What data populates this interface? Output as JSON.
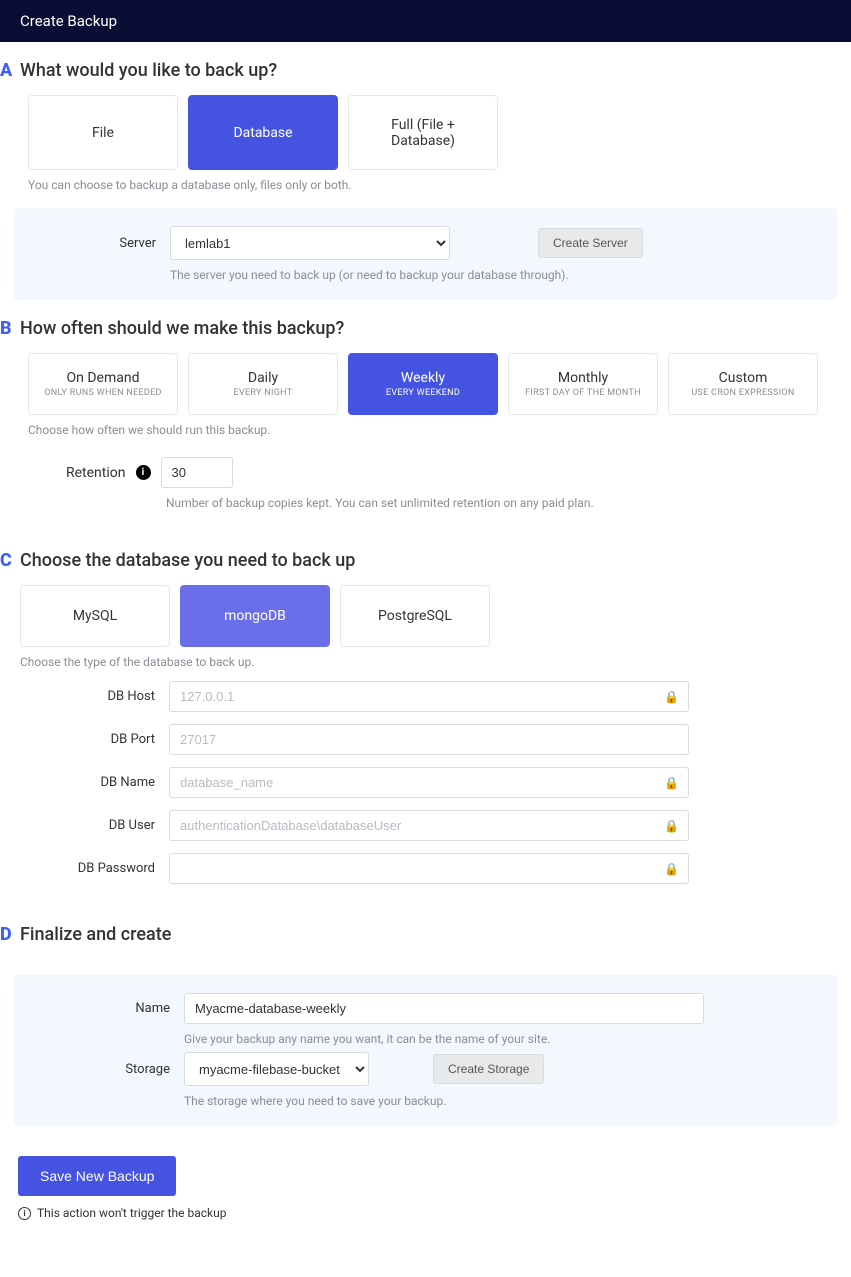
{
  "header": {
    "title": "Create Backup"
  },
  "sectionA": {
    "letter": "A",
    "heading": "What would you like to back up?",
    "options": {
      "file": "File",
      "database": "Database",
      "full": "Full (File + Database)"
    },
    "helper": "You can choose to backup a database only, files only or both.",
    "server_label": "Server",
    "server_value": "lemlab1",
    "create_server_btn": "Create Server",
    "server_helper": "The server you need to back up (or need to backup your database through)."
  },
  "sectionB": {
    "letter": "B",
    "heading": "How often should we make this backup?",
    "freq": {
      "ondemand": {
        "title": "On Demand",
        "sub": "ONLY RUNS WHEN NEEDED"
      },
      "daily": {
        "title": "Daily",
        "sub": "EVERY NIGHT"
      },
      "weekly": {
        "title": "Weekly",
        "sub": "EVERY WEEKEND"
      },
      "monthly": {
        "title": "Monthly",
        "sub": "FIRST DAY OF THE MONTH"
      },
      "custom": {
        "title": "Custom",
        "sub": "USE CRON EXPRESSION"
      }
    },
    "helper": "Choose how often we should run this backup.",
    "retention_label": "Retention",
    "retention_value": "30",
    "retention_helper": "Number of backup copies kept. You can set unlimited retention on any paid plan."
  },
  "sectionC": {
    "letter": "C",
    "heading": "Choose the database you need to back up",
    "db": {
      "mysql": "MySQL",
      "mongodb": "mongoDB",
      "postgresql": "PostgreSQL"
    },
    "helper": "Choose the type of the database to back up.",
    "fields": {
      "host_label": "DB Host",
      "host_placeholder": "127.0.0.1",
      "port_label": "DB Port",
      "port_placeholder": "27017",
      "name_label": "DB Name",
      "name_placeholder": "database_name",
      "user_label": "DB User",
      "user_placeholder": "authenticationDatabase\\databaseUser",
      "pwd_label": "DB Password"
    }
  },
  "sectionD": {
    "letter": "D",
    "heading": "Finalize and create",
    "name_label": "Name",
    "name_value": "Myacme-database-weekly",
    "name_helper": "Give your backup any name you want, it can be the name of your site.",
    "storage_label": "Storage",
    "storage_value": "myacme-filebase-bucket",
    "create_storage_btn": "Create Storage",
    "storage_helper": "The storage where you need to save your backup."
  },
  "footer": {
    "save_btn": "Save New Backup",
    "note": "This action won't trigger the backup"
  }
}
